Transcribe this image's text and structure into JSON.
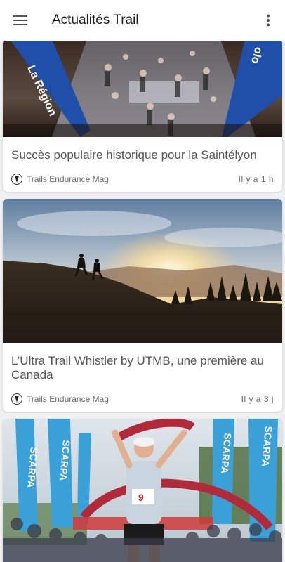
{
  "appbar": {
    "title": "Actualités Trail",
    "menu_icon": "hamburger-menu-icon",
    "more_icon": "more-vert-icon"
  },
  "articles": [
    {
      "headline": "Succès populaire historique pour la Saintélyon",
      "source": "Trails Endurance Mag",
      "time": "Il y a 1 h",
      "image_banner_text": "La Région"
    },
    {
      "headline": "L’Ultra Trail Whistler by UTMB, une première au Canada",
      "source": "Trails Endurance Mag",
      "time": "Il y a 3 j"
    },
    {
      "image_banner_text": "SCARPA",
      "bib_number": "9"
    }
  ]
}
